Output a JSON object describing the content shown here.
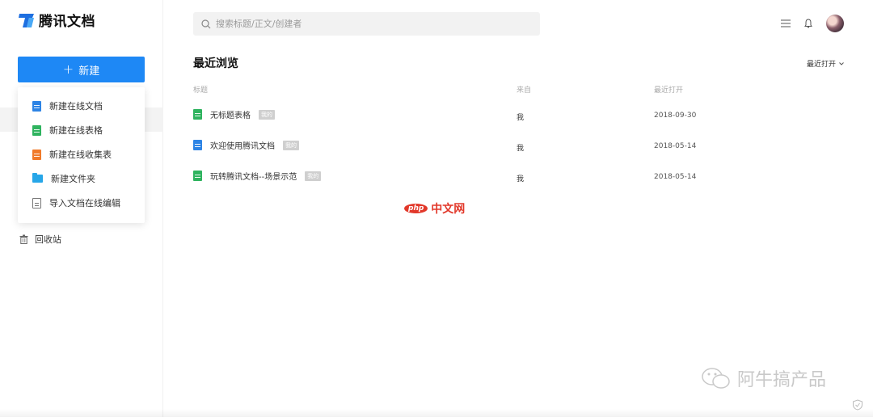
{
  "app": {
    "name": "腾讯文档"
  },
  "sidebar": {
    "new_button": {
      "plus": "+",
      "label": "新建"
    },
    "menu": [
      {
        "label": "新建在线文档",
        "icon": "doc-icon"
      },
      {
        "label": "新建在线表格",
        "icon": "sheet-icon"
      },
      {
        "label": "新建在线收集表",
        "icon": "form-icon"
      },
      {
        "label": "新建文件夹",
        "icon": "folder-icon"
      },
      {
        "label": "导入文档在线编辑",
        "icon": "import-icon"
      }
    ],
    "trash_label": "回收站"
  },
  "search": {
    "placeholder": "搜索标题/正文/创建者"
  },
  "main": {
    "title": "最近浏览",
    "sort_label": "最近打开",
    "columns": {
      "title": "标题",
      "from": "来自",
      "date": "最近打开"
    },
    "rows": [
      {
        "name": "无标题表格",
        "badge": "我的",
        "type": "sheet",
        "from": "我",
        "date": "2018-09-30"
      },
      {
        "name": "欢迎使用腾讯文档",
        "badge": "我的",
        "type": "doc",
        "from": "我",
        "date": "2018-05-14"
      },
      {
        "name": "玩转腾讯文档--场景示范",
        "badge": "我的",
        "type": "sheet",
        "from": "我",
        "date": "2018-05-14"
      }
    ]
  },
  "watermarks": {
    "php_logo": "php",
    "php_site": "中文网",
    "account": "阿牛搞产品"
  },
  "colors": {
    "accent": "#1e88f5",
    "sheet": "#2fb35f",
    "doc": "#2d84e5",
    "form": "#f07a2a",
    "folder": "#27a6e8",
    "watermark_red": "#e2382a"
  }
}
